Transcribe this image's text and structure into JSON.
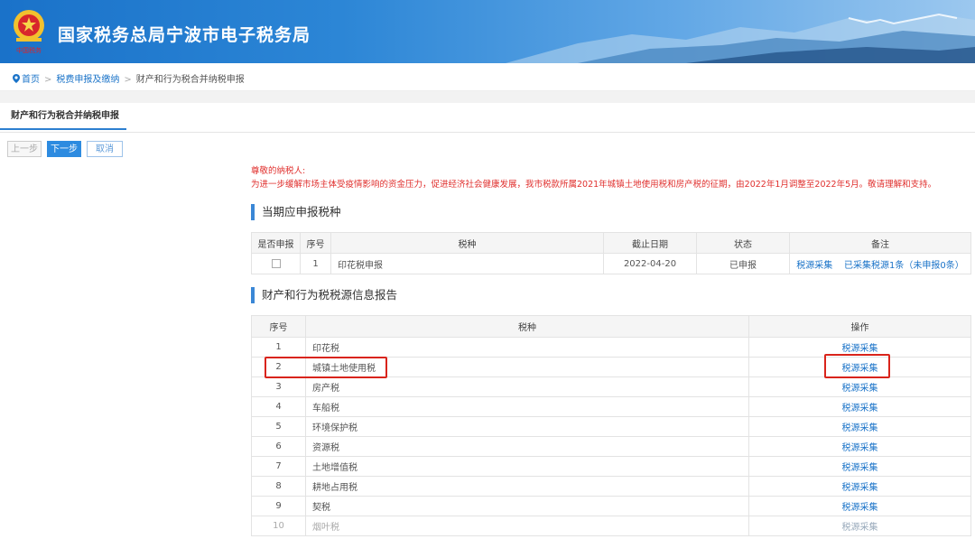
{
  "header": {
    "title": "国家税务总局宁波市电子税务局",
    "emblem_caption": "中国税务"
  },
  "breadcrumb": {
    "home": "首页",
    "level2": "税费申报及缴纳",
    "current": "财产和行为税合并纳税申报",
    "separator": ">"
  },
  "tab": {
    "label": "财产和行为税合并纳税申报"
  },
  "buttons": {
    "prev": "上一步",
    "next": "下一步",
    "cancel": "取消"
  },
  "notice": {
    "greeting": "尊敬的纳税人:",
    "body": "为进一步缓解市场主体受疫情影响的资金压力，促进经济社会健康发展，我市税款所属2021年城镇土地使用税和房产税的征期，由2022年1月调整至2022年5月。敬请理解和支持。"
  },
  "section1": {
    "title": "当期应申报税种",
    "headers": [
      "是否申报",
      "序号",
      "税种",
      "截止日期",
      "状态",
      "备注"
    ],
    "row": {
      "seq": "1",
      "tax": "印花税申报",
      "deadline": "2022-04-20",
      "status": "已申报",
      "remark_link1": "税源采集",
      "remark_link2": "已采集税源1条（未申报0条）"
    }
  },
  "section2": {
    "title": "财产和行为税税源信息报告",
    "headers": [
      "序号",
      "税种",
      "操作"
    ],
    "rows": [
      {
        "seq": "1",
        "tax": "印花税",
        "action": "税源采集"
      },
      {
        "seq": "2",
        "tax": "城镇土地使用税",
        "action": "税源采集"
      },
      {
        "seq": "3",
        "tax": "房产税",
        "action": "税源采集"
      },
      {
        "seq": "4",
        "tax": "车船税",
        "action": "税源采集"
      },
      {
        "seq": "5",
        "tax": "环境保护税",
        "action": "税源采集"
      },
      {
        "seq": "6",
        "tax": "资源税",
        "action": "税源采集"
      },
      {
        "seq": "7",
        "tax": "土地增值税",
        "action": "税源采集"
      },
      {
        "seq": "8",
        "tax": "耕地占用税",
        "action": "税源采集"
      },
      {
        "seq": "9",
        "tax": "契税",
        "action": "税源采集"
      },
      {
        "seq": "10",
        "tax": "烟叶税",
        "action": "税源采集"
      }
    ]
  },
  "colors": {
    "header_blue": "#1a72c9",
    "accent": "#2d8be0",
    "link": "#1a73c8",
    "notice_red": "#e0302e",
    "highlight_red": "#d9241b"
  }
}
